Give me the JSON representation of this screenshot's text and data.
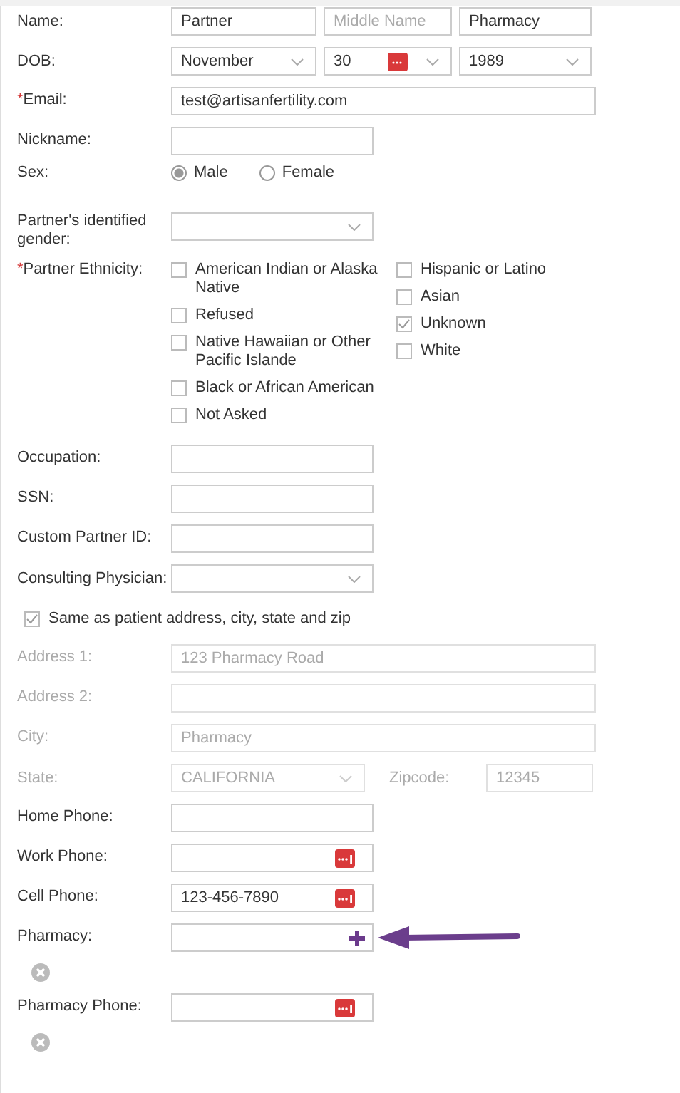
{
  "rows": [
    {
      "kind": "inputs",
      "label": "Name:",
      "fields": [
        {
          "value": "Partner"
        },
        {
          "placeholder": "Middle Name"
        },
        {
          "value": "Pharmacy"
        }
      ]
    },
    {
      "kind": "selects",
      "label": "DOB:",
      "fields": [
        {
          "value": "November"
        },
        {
          "value": "30",
          "calendar": true
        },
        {
          "value": "1989"
        }
      ]
    },
    {
      "kind": "text",
      "label": "Email:",
      "required_mark": "*",
      "value": "test@artisanfertility.com",
      "long": true
    },
    {
      "kind": "text",
      "label": "Nickname:"
    },
    {
      "kind": "radio",
      "label": "Sex:",
      "options": [
        {
          "label": "Male",
          "selected": true
        },
        {
          "label": "Female",
          "selected": false
        }
      ]
    },
    {
      "kind": "select",
      "label": "Partner's identified gender:"
    },
    {
      "kind": "checkboxes",
      "label": "Partner Ethnicity:",
      "required_mark": "*",
      "columns": [
        [
          {
            "label": "American Indian or Alaska Native",
            "checked": false
          },
          {
            "label": "Refused",
            "checked": false
          },
          {
            "label": "Native Hawaiian or Other Pacific Islande",
            "checked": false
          },
          {
            "label": "Black or African American",
            "checked": false
          },
          {
            "label": "Not Asked",
            "checked": false
          }
        ],
        [
          {
            "label": "Hispanic or Latino",
            "checked": false
          },
          {
            "label": "Asian",
            "checked": false
          },
          {
            "label": "Unknown",
            "checked": true
          },
          {
            "label": "White",
            "checked": false
          }
        ]
      ]
    },
    {
      "kind": "text",
      "label": "Occupation:"
    },
    {
      "kind": "text",
      "label": "SSN:"
    },
    {
      "kind": "text",
      "label": "Custom Partner ID:"
    },
    {
      "kind": "select",
      "label": "Consulting Physician:"
    },
    {
      "kind": "checkbox",
      "label": "Same as patient address, city, state and zip",
      "checked": true
    },
    {
      "kind": "text",
      "label": "Address 1:",
      "value": "123 Pharmacy Road",
      "long": true,
      "disabled": true
    },
    {
      "kind": "text",
      "label": "Address 2:",
      "long": true,
      "disabled": true
    },
    {
      "kind": "text",
      "label": "City:",
      "value": "Pharmacy",
      "long": true,
      "disabled": true
    },
    {
      "kind": "state",
      "label": "State:",
      "value": "CALIFORNIA",
      "zip_label": "Zipcode:",
      "zip_value": "12345",
      "disabled": true
    },
    {
      "kind": "text",
      "label": "Home Phone:"
    },
    {
      "kind": "text",
      "label": "Work Phone:",
      "phone_button": true
    },
    {
      "kind": "text",
      "label": "Cell Phone:",
      "value": "123-456-7890",
      "phone_button": true
    },
    {
      "kind": "text",
      "label": "Pharmacy:",
      "add_button": true,
      "remove_button": true,
      "pointer_arrow": true
    },
    {
      "kind": "text",
      "label": "Pharmacy Phone:",
      "phone_button": true,
      "remove_button": true
    }
  ]
}
